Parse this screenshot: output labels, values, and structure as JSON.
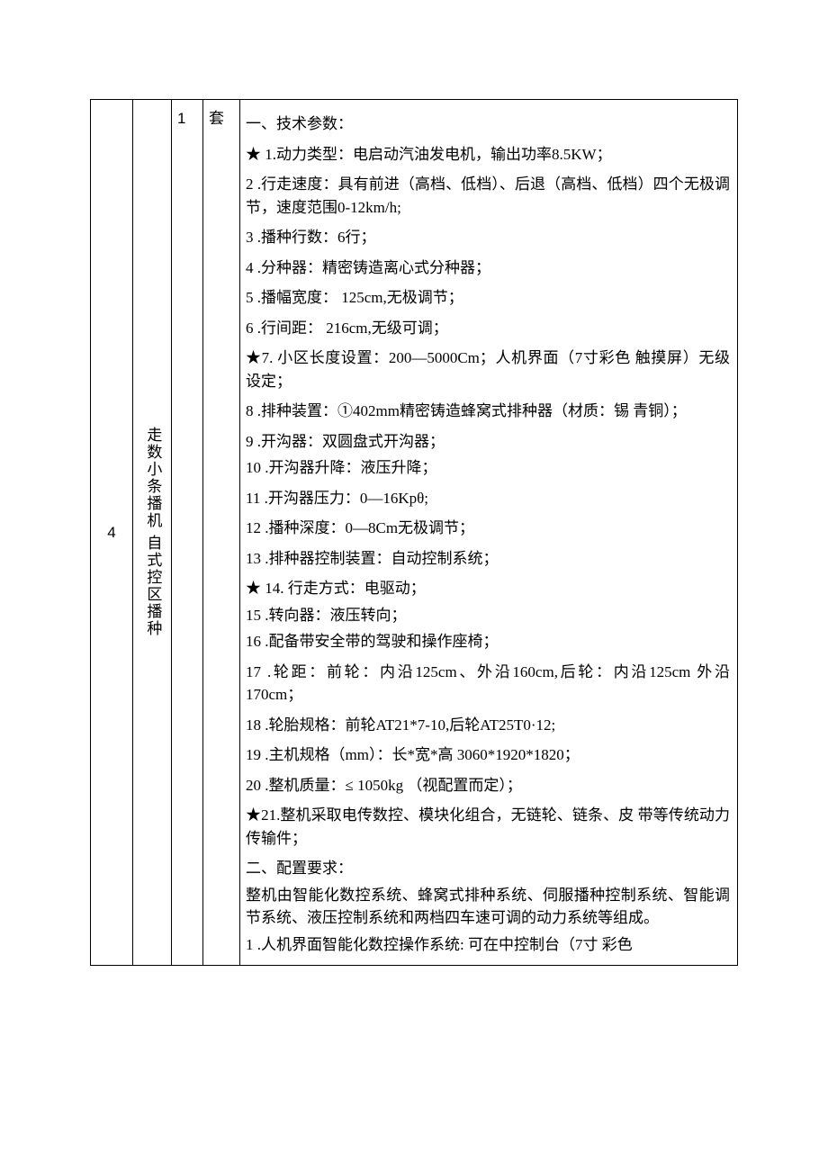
{
  "row": {
    "index": "4",
    "name": "走数小条播机 自式控区播种",
    "qty": "1",
    "unit": "套",
    "spec": [
      "一、技术参数：",
      "★ 1.动力类型：电启动汽油发电机，输出功率8.5KW；",
      "2 .行走速度：具有前进（高档、低档）、后退（高档、低档）四个无极调节，速度范围0-12km/h;",
      "3 .播种行数：6行；",
      "4 .分种器：精密铸造离心式分种器；",
      "5 .播幅宽度： 125cm,无极调节；",
      "6 .行间距： 216cm,无级可调；",
      "★7. 小区长度设置：200—5000Cm；人机界面（7寸彩色  触摸屏）无级设定；",
      "8 .排种装置：①402mm精密铸造蜂窝式排种器（材质：锡  青铜）；",
      "9 .开沟器：双圆盘式开沟器；",
      "10 .开沟器升降：液压升降；",
      "11 .开沟器压力：0—16Kpθ;",
      "12 .播种深度：0—8Cm无极调节；",
      "13 .排种器控制装置：自动控制系统；",
      "★ 14. 行走方式：电驱动；",
      "15 .转向器：液压转向；",
      "16 .配备带安全带的驾驶和操作座椅；",
      "17 .轮距：前轮：内沿125cm、外沿160cm,后轮：内沿125cm 外沿 170cm；",
      "18 .轮胎规格：前轮AT21*7-10,后轮AT25T0·12;",
      "19 .主机规格（mm）：长*宽*高 3060*1920*1820；",
      "20 .整机质量：≤ 1050kg （视配置而定）；",
      "★21.整机采取电传数控、模块化组合，无链轮、链条、皮 带等传统动力传输件；",
      "二、配置要求：",
      "整机由智能化数控系统、蜂窝式排种系统、伺服播种控制系统、智能调节系统、液压控制系统和两档四车速可调的动力系统等组成。",
      "1 .人机界面智能化数控操作系统: 可在中控制台（7寸 彩色"
    ]
  }
}
